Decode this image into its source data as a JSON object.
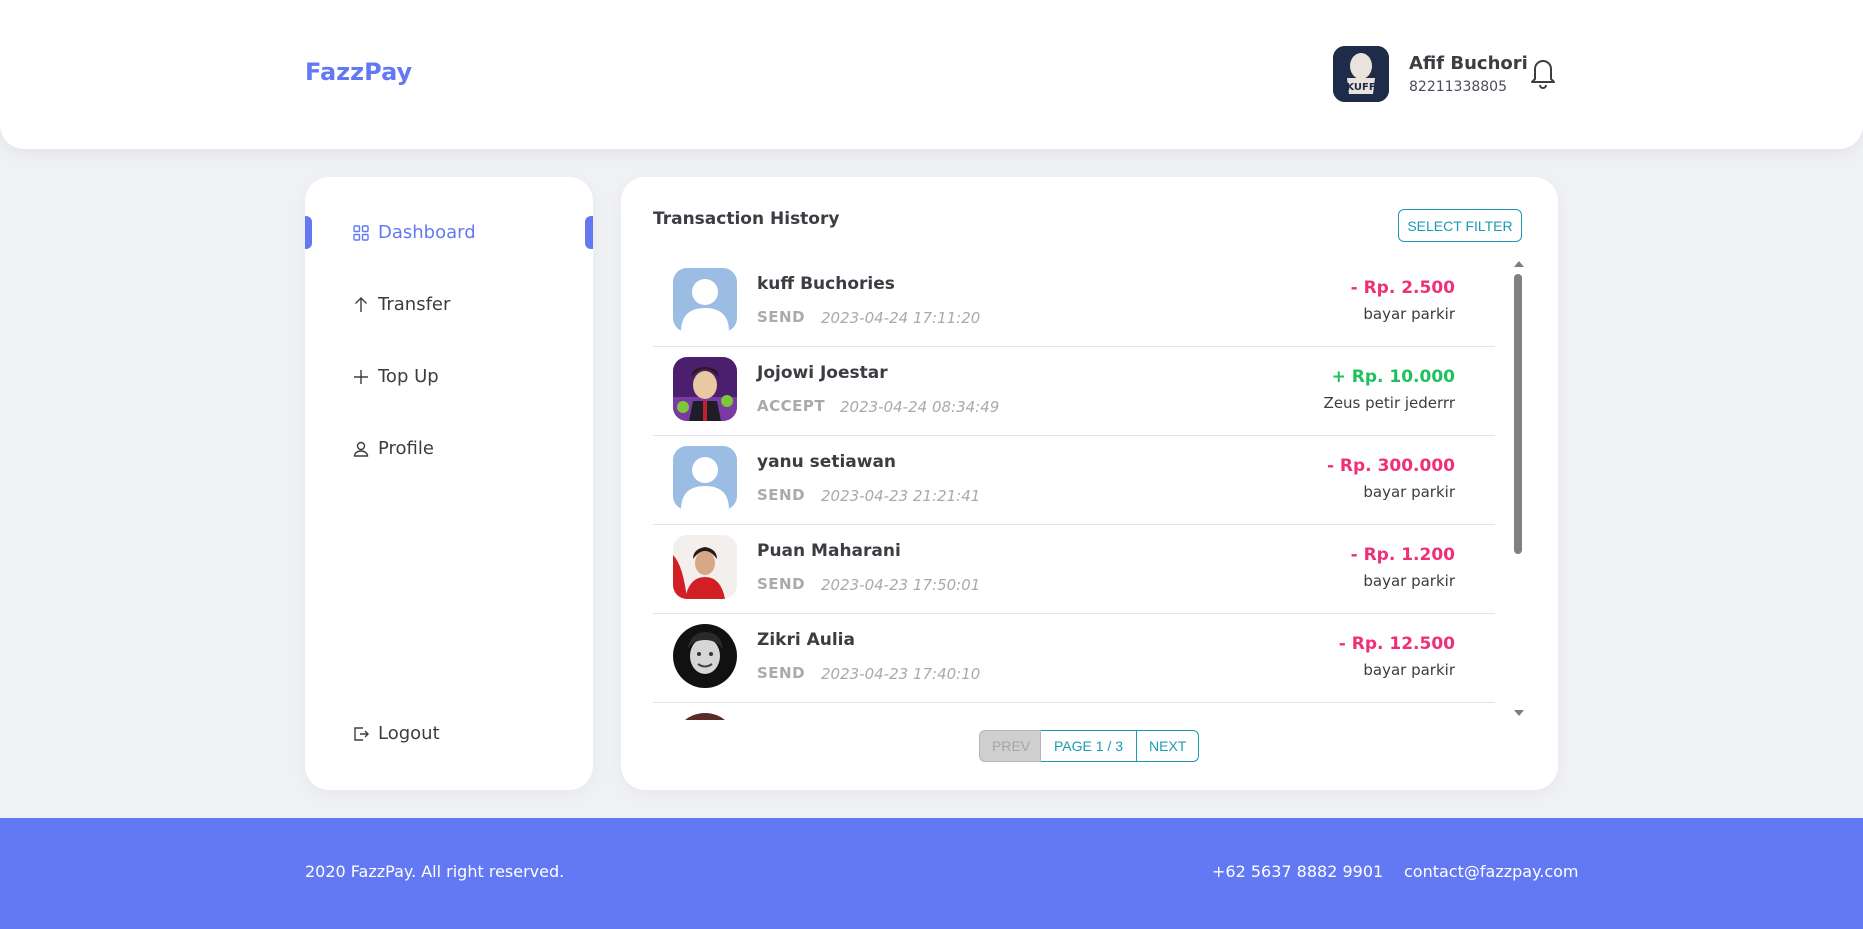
{
  "header": {
    "brand": "FazzPay",
    "user_name": "Afif Buchori",
    "user_phone": "82211338805",
    "avatar_text": "KUFF"
  },
  "sidebar": {
    "items": [
      {
        "label": "Dashboard",
        "icon": "grid-icon",
        "active": true
      },
      {
        "label": "Transfer",
        "icon": "arrow-up-icon",
        "active": false
      },
      {
        "label": "Top Up",
        "icon": "plus-icon",
        "active": false
      },
      {
        "label": "Profile",
        "icon": "user-icon",
        "active": false
      }
    ],
    "logout_label": "Logout"
  },
  "main": {
    "title": "Transaction History",
    "filter_label": "SELECT FILTER",
    "transactions": [
      {
        "name": "kuff Buchories",
        "type": "SEND",
        "date": "2023-04-24 17:11:20",
        "amount": "- Rp. 2.500",
        "note": "bayar parkir",
        "direction": "out",
        "avatar": "placeholder"
      },
      {
        "name": "Jojowi Joestar",
        "type": "ACCEPT",
        "date": "2023-04-24 08:34:49",
        "amount": "+ Rp. 10.000",
        "note": "Zeus petir jederrr",
        "direction": "in",
        "avatar": "photo-purple"
      },
      {
        "name": "yanu setiawan",
        "type": "SEND",
        "date": "2023-04-23 21:21:41",
        "amount": "- Rp. 300.000",
        "note": "bayar parkir",
        "direction": "out",
        "avatar": "placeholder"
      },
      {
        "name": "Puan Maharani",
        "type": "SEND",
        "date": "2023-04-23 17:50:01",
        "amount": "- Rp. 1.200",
        "note": "bayar parkir",
        "direction": "out",
        "avatar": "photo-red"
      },
      {
        "name": "Zikri Aulia",
        "type": "SEND",
        "date": "2023-04-23 17:40:10",
        "amount": "- Rp. 12.500",
        "note": "bayar parkir",
        "direction": "out",
        "avatar": "photo-bw"
      }
    ],
    "pager": {
      "prev": "PREV",
      "page": "PAGE 1 / 3",
      "next": "NEXT"
    }
  },
  "footer": {
    "copyright": "2020 FazzPay. All right reserved.",
    "phone": "+62 5637 8882 9901",
    "email": "contact@fazzpay.com"
  },
  "colors": {
    "primary": "#6379f4",
    "negative": "#ef2f78",
    "positive": "#1ec15f",
    "accent": "#1a9bb3"
  }
}
